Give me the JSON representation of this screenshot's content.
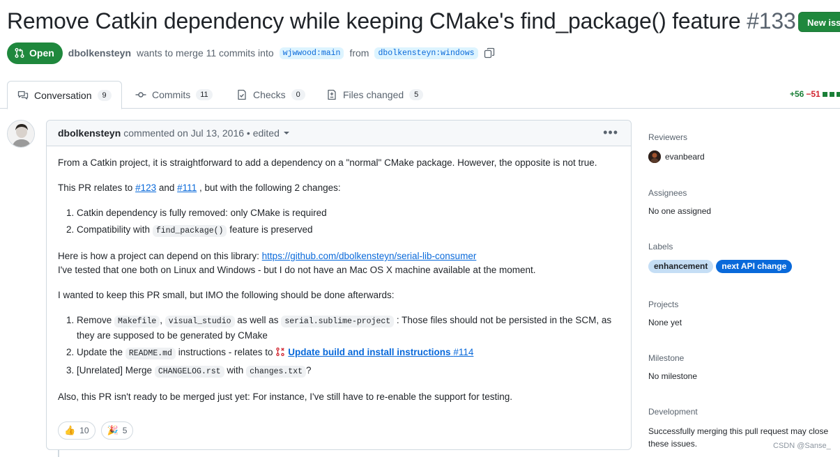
{
  "header": {
    "title": "Remove Catkin dependency while keeping CMake's find_package() feature",
    "number": "#133",
    "new_issue_label": "New issu"
  },
  "pr_meta": {
    "state": "Open",
    "author": "dbolkensteyn",
    "action_text": "wants to merge 11 commits into",
    "base_branch": "wjwwood:main",
    "from_text": "from",
    "head_branch": "dbolkensteyn:windows"
  },
  "tabs": [
    {
      "label": "Conversation",
      "count": "9",
      "icon": "comment-discussion-icon"
    },
    {
      "label": "Commits",
      "count": "11",
      "icon": "commit-icon"
    },
    {
      "label": "Checks",
      "count": "0",
      "icon": "checklist-icon"
    },
    {
      "label": "Files changed",
      "count": "5",
      "icon": "file-diff-icon"
    }
  ],
  "diffstat": {
    "additions": "+56",
    "deletions": "−51",
    "colors": {
      "add": "#1a7f37",
      "del": "#d1242f",
      "neutral": "#d1d9e0"
    }
  },
  "comment": {
    "author": "dbolkensteyn",
    "meta": "commented on Jul 13, 2016 • edited",
    "p1": "From a Catkin project, it is straightforward to add a dependency on a \"normal\" CMake package. However, the opposite is not true.",
    "p2_a": "This PR relates to",
    "p2_link1": "#123",
    "p2_and": "and",
    "p2_link2": "#111",
    "p2_b": ", but with the following 2 changes:",
    "list1": [
      {
        "text": "Catkin dependency is fully removed: only CMake is required"
      },
      {
        "text_a": "Compatibility with",
        "code": "find_package()",
        "text_b": "feature is preserved"
      }
    ],
    "p3_a": "Here is how a project can depend on this library:",
    "p3_link": "https://github.com/dbolkensteyn/serial-lib-consumer",
    "p3_b": "I've tested that one both on Linux and Windows - but I do not have an Mac OS X machine available at the moment.",
    "p4": "I wanted to keep this PR small, but IMO the following should be done afterwards:",
    "list2": {
      "item1_a": "Remove",
      "item1_code1": "Makefile",
      "item1_comma": ",",
      "item1_code2": "visual_studio",
      "item1_b": "as well as",
      "item1_code3": "serial.sublime-project",
      "item1_c": ": Those files should not be persisted in the SCM, as they are supposed to be generated by CMake",
      "item2_a": "Update the",
      "item2_code": "README.md",
      "item2_b": "instructions - relates to",
      "item2_ref_title": "Update build and install instructions",
      "item2_ref_num": "#114",
      "item3_a": "[Unrelated] Merge",
      "item3_code1": "CHANGELOG.rst",
      "item3_b": "with",
      "item3_code2": "changes.txt",
      "item3_c": "?"
    },
    "p5": "Also, this PR isn't ready to be merged just yet: For instance, I've still have to re-enable the support for testing.",
    "reactions": [
      {
        "emoji": "👍",
        "name": "thumbs-up",
        "count": "10"
      },
      {
        "emoji": "🎉",
        "name": "hooray",
        "count": "5"
      }
    ]
  },
  "sidebar": {
    "reviewers": {
      "heading": "Reviewers",
      "name": "evanbeard"
    },
    "assignees": {
      "heading": "Assignees",
      "value": "No one assigned"
    },
    "labels": {
      "heading": "Labels",
      "items": [
        {
          "name": "enhancement",
          "bg": "#c5def5",
          "fg": "#1f2328"
        },
        {
          "name": "next API change",
          "bg": "#0969da",
          "fg": "#ffffff"
        }
      ]
    },
    "projects": {
      "heading": "Projects",
      "value": "None yet"
    },
    "milestone": {
      "heading": "Milestone",
      "value": "No milestone"
    },
    "development": {
      "heading": "Development",
      "value": "Successfully merging this pull request may close these issues."
    }
  },
  "watermark": "CSDN @Sanse_"
}
